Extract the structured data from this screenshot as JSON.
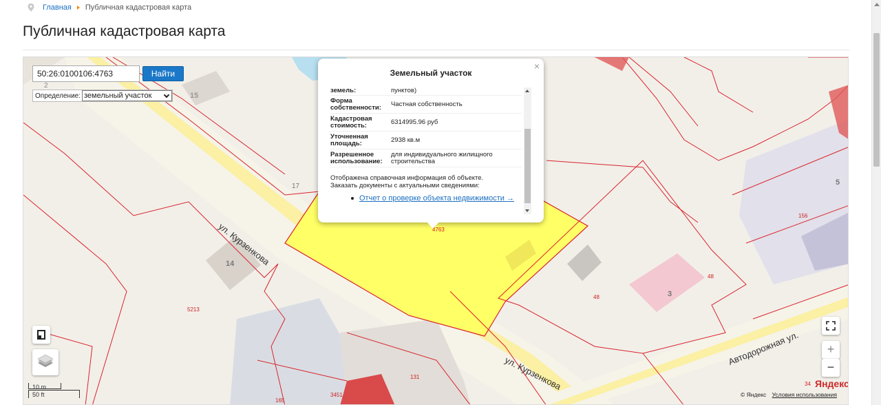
{
  "breadcrumb": {
    "home": "Главная",
    "current": "Публичная кадастровая карта"
  },
  "page": {
    "title": "Публичная кадастровая карта"
  },
  "search": {
    "value": "50:26:0100106:4763",
    "button": "Найти",
    "definition_label": "Определение:",
    "definition_value": "земельный участок"
  },
  "popup": {
    "title": "Земельный участок",
    "close": "×",
    "rows": [
      {
        "key": "земель:",
        "value": "пунктов)"
      },
      {
        "key": "Форма собственности:",
        "value": "Частная собственность"
      },
      {
        "key": "Кадастровая стоимость:",
        "value": "6314995.96 руб"
      },
      {
        "key": "Уточненная площадь:",
        "value": "2938 кв.м"
      },
      {
        "key": "Разрешенное использование:",
        "value": "для индивидуального жилищного строительства"
      }
    ],
    "note_line1": "Отображена справочная информация об объекте.",
    "note_line2": "Заказать документы с актуальными сведениями:",
    "link": "Отчет о проверке объекта недвижимости →"
  },
  "map": {
    "labels": {
      "num_2": "2",
      "num_15": "15",
      "num_17": "17",
      "num_14": "14",
      "num_5213": "5213",
      "num_4763": "4763",
      "num_48a": "48",
      "num_48b": "48",
      "num_3": "3",
      "num_156": "156",
      "num_5": "5",
      "num_131": "131",
      "num_3451": "3451",
      "num_165": "165",
      "num_34": "34",
      "street_kurzenkova_1": "ул. Курзенкова",
      "street_kurzenkova_2": "ул. Курзенкова",
      "street_avtodorozhnaya": "Автодорожная ул."
    },
    "highlight_color": "#ffff66",
    "boundary_color": "#d9232b"
  },
  "scale": {
    "meters": "10 m",
    "feet": "50 ft"
  },
  "attribution": {
    "logo": "Яндекс",
    "copyright": "© Яндекс",
    "terms": "Условия использования"
  },
  "controls": {
    "zoom_in": "+",
    "zoom_out": "−"
  }
}
